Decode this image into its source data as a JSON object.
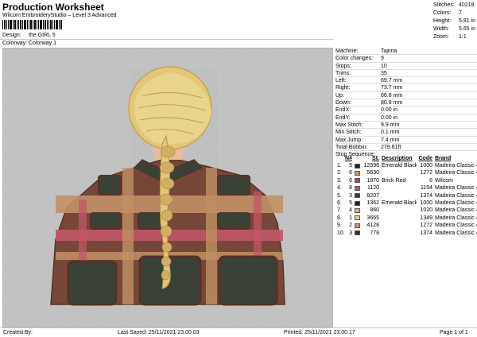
{
  "header": {
    "title": "Production Worksheet",
    "subtitle": "Wilcom EmbroideryStudio – Level 3 Advanced"
  },
  "meta": {
    "design_label": "Design:",
    "design_value": "the GIRL 5",
    "colorway_label": "Colorway:",
    "colorway_value": "Colorway 1"
  },
  "stats": [
    {
      "k": "Stitches:",
      "v": "40218"
    },
    {
      "k": "Colors:",
      "v": "7"
    },
    {
      "k": "Height:",
      "v": "5.81 in"
    },
    {
      "k": "Width:",
      "v": "5.65 in"
    },
    {
      "k": "Zoom:",
      "v": "1:1"
    }
  ],
  "info": [
    {
      "k": "Machine:",
      "v": "Tajima"
    },
    {
      "k": "Color changes:",
      "v": "9"
    },
    {
      "k": "Stops:",
      "v": "10"
    },
    {
      "k": "Trims:",
      "v": "35"
    },
    {
      "k": "Left:",
      "v": "69.7 mm"
    },
    {
      "k": "Right:",
      "v": "73.7 mm"
    },
    {
      "k": "Up:",
      "v": "66.8 mm"
    },
    {
      "k": "Down:",
      "v": "80.8 mm"
    },
    {
      "k": "EndX:",
      "v": "0.00 in"
    },
    {
      "k": "EndY:",
      "v": "0.00 in"
    },
    {
      "k": "Max Stitch:",
      "v": "9.9 mm"
    },
    {
      "k": "Min Stitch:",
      "v": "0.1 mm"
    },
    {
      "k": "Max Jump:",
      "v": "7.4 mm"
    },
    {
      "k": "Total Bobbin:",
      "v": "279.61ft"
    }
  ],
  "stop_sequence": {
    "label": "Stop Sequence:",
    "headers": {
      "n": "N#",
      "st": "St.",
      "desc": "Description",
      "code": "Code",
      "brand": "Brand"
    },
    "rows": [
      {
        "i": "1.",
        "n": "5",
        "color": "#1e1e1e",
        "st": "12596",
        "desc": "Emerald Black",
        "code": "1000",
        "brand": "Madeira Classic 40"
      },
      {
        "i": "2.",
        "n": "6",
        "color": "#c8956a",
        "st": "5630",
        "desc": "",
        "code": "1272",
        "brand": "Madeira Classic 40"
      },
      {
        "i": "3.",
        "n": "6",
        "color": "#b04a4a",
        "st": "1870",
        "desc": "Brick Red",
        "code": "6",
        "brand": "Wilcom"
      },
      {
        "i": "4.",
        "n": "8",
        "color": "#d04a6a",
        "st": "1120",
        "desc": "",
        "code": "1154",
        "brand": "Madeira Classic 40"
      },
      {
        "i": "5.",
        "n": "3",
        "color": "#3a3a3a",
        "st": "8207",
        "desc": "",
        "code": "1374",
        "brand": "Madeira Classic 40"
      },
      {
        "i": "6.",
        "n": "5",
        "color": "#1e1e1e",
        "st": "1362",
        "desc": "Emerald Black",
        "code": "1000",
        "brand": "Madeira Classic 40"
      },
      {
        "i": "7.",
        "n": "4",
        "color": "#e8a0a0",
        "st": "860",
        "desc": "",
        "code": "1020",
        "brand": "Madeira Classic 40"
      },
      {
        "i": "8.",
        "n": "1",
        "color": "#ecd78c",
        "st": "3665",
        "desc": "",
        "code": "1349",
        "brand": "Madeira Classic 40"
      },
      {
        "i": "9.",
        "n": "2",
        "color": "#c8956a",
        "st": "4128",
        "desc": "",
        "code": "1272",
        "brand": "Madeira Classic 40"
      },
      {
        "i": "10.",
        "n": "3",
        "color": "#4a2a2a",
        "st": "778",
        "desc": "",
        "code": "1374",
        "brand": "Madeira Classic 40"
      }
    ]
  },
  "footer": {
    "created_by": "Created By:",
    "last_saved": "Last Saved: 25/11/2021 23.00.03",
    "printed": "Printed: 25/11/2021 23.00.17",
    "page": "Page 1 of 1"
  },
  "colors": {
    "canvas_bg": "#c8c8c8",
    "hair": "#e6c878",
    "jacket_dark": "#3c4438",
    "jacket_brown": "#7a4a3a",
    "jacket_pink": "#c85a6a",
    "jacket_tan": "#c8956a"
  }
}
